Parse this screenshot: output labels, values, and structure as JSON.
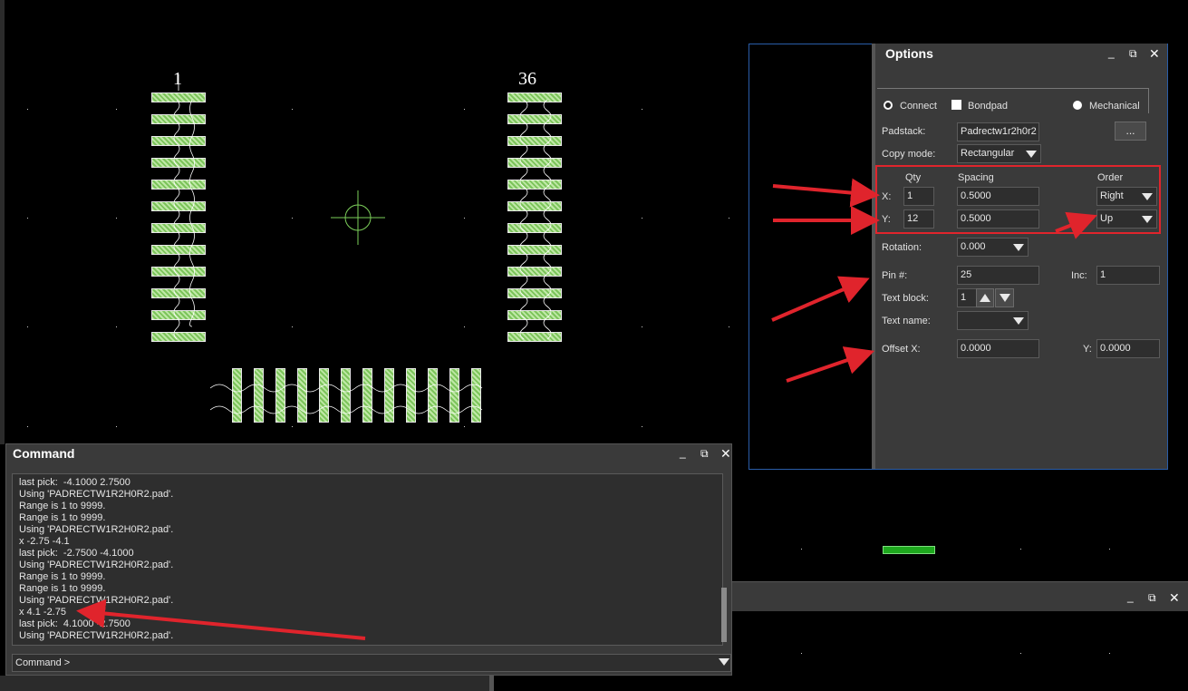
{
  "canvas": {
    "pin_label_left": "1",
    "pin_label_right": "36"
  },
  "options": {
    "title": "Options",
    "window_buttons": {
      "minimize": "_",
      "restore": "⧉",
      "close": "✕"
    },
    "type_radios": {
      "connect": "Connect",
      "bondpad": "Bondpad",
      "mechanical": "Mechanical"
    },
    "padstack_label": "Padstack:",
    "padstack_value": "Padrectw1r2h0r2",
    "browse_label": "...",
    "copy_mode_label": "Copy mode:",
    "copy_mode_value": "Rectangular",
    "qty_header": "Qty",
    "spacing_header": "Spacing",
    "order_header": "Order",
    "x_label": "X:",
    "y_label": "Y:",
    "x_qty": "1",
    "y_qty": "12",
    "x_spacing": "0.5000",
    "y_spacing": "0.5000",
    "x_order": "Right",
    "y_order": "Up",
    "rotation_label": "Rotation:",
    "rotation_value": "0.000",
    "pin_label": "Pin #:",
    "pin_value": "25",
    "inc_label": "Inc:",
    "inc_value": "1",
    "text_block_label": "Text block:",
    "text_block_value": "1",
    "text_name_label": "Text name:",
    "text_name_value": "",
    "offset_x_label": "Offset X:",
    "offset_x_value": "0.0000",
    "offset_y_label": "Y:",
    "offset_y_value": "0.0000"
  },
  "command": {
    "title": "Command",
    "window_buttons": {
      "minimize": "_",
      "restore": "⧉",
      "close": "✕"
    },
    "log": [
      "last pick:  -4.1000 2.7500",
      "Using 'PADRECTW1R2H0R2.pad'.",
      "Range is 1 to 9999.",
      "Range is 1 to 9999.",
      "Using 'PADRECTW1R2H0R2.pad'.",
      "x -2.75 -4.1",
      "last pick:  -2.7500 -4.1000",
      "Using 'PADRECTW1R2H0R2.pad'.",
      "Range is 1 to 9999.",
      "Range is 1 to 9999.",
      "Using 'PADRECTW1R2H0R2.pad'.",
      "x 4.1 -2.75",
      "last pick:  4.1000 -2.7500",
      "Using 'PADRECTW1R2H0R2.pad'."
    ],
    "prompt": "Command >"
  },
  "bottom_panel": {
    "window_buttons": {
      "minimize": "_",
      "restore": "⧉",
      "close": "✕"
    }
  },
  "colors": {
    "pad_fill": "#8bd06a",
    "annotation_red": "#e0242c",
    "panel_bg": "#3a3a3a",
    "canvas_bg": "#000000"
  }
}
